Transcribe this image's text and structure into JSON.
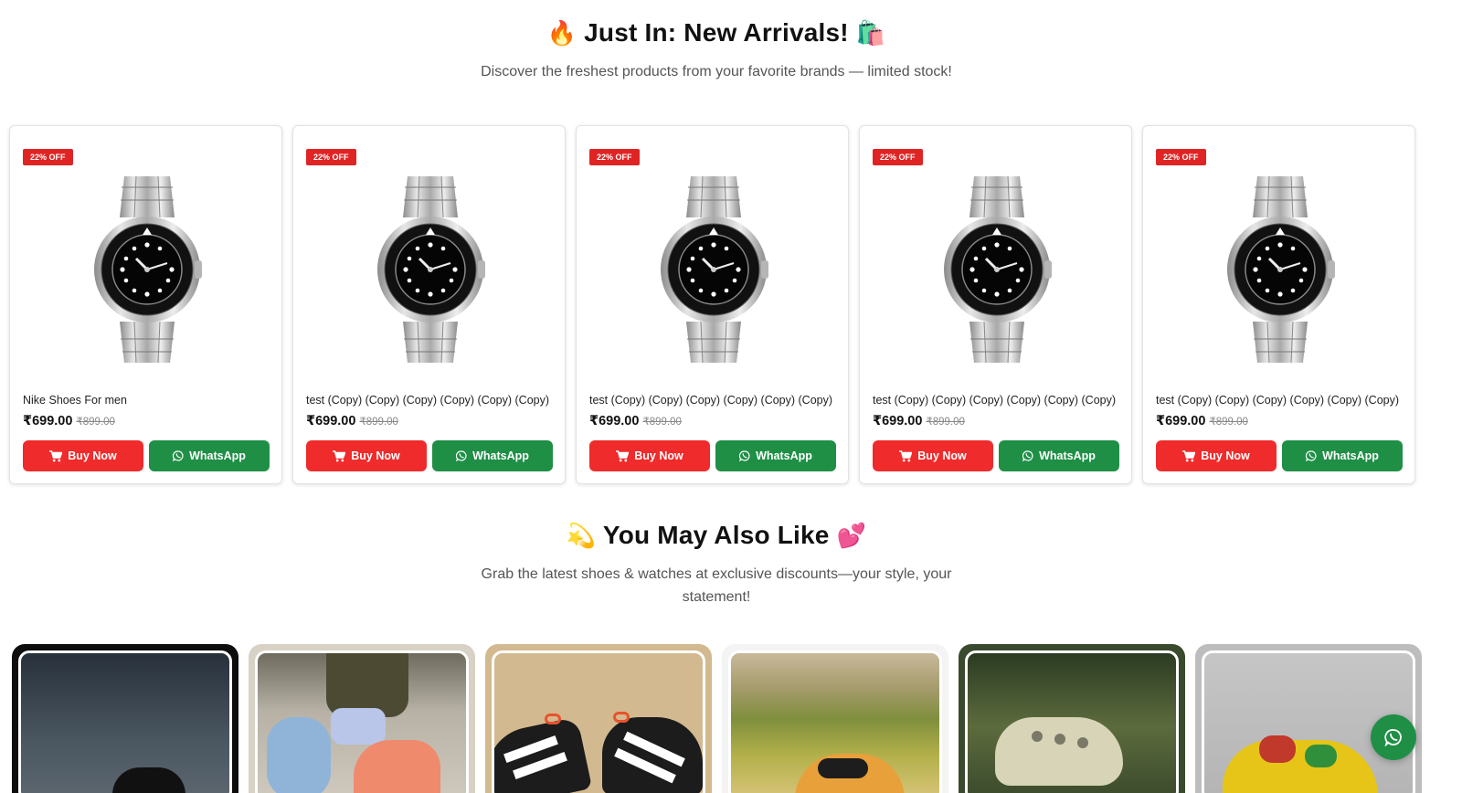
{
  "arrivals": {
    "title_emoji_left": "🔥",
    "title": "Just In: New Arrivals!",
    "title_emoji_right": "🛍️",
    "subtitle": "Discover the freshest products from your favorite brands — limited stock!"
  },
  "products": [
    {
      "badge": "22% OFF",
      "name": "Nike Shoes For men",
      "price": "₹699.00",
      "mrp": "₹899.00",
      "buy_label": "Buy Now",
      "whatsapp_label": "WhatsApp",
      "image_icon": "watch-image"
    },
    {
      "badge": "22% OFF",
      "name": "test (Copy) (Copy) (Copy) (Copy) (Copy) (Copy)",
      "price": "₹699.00",
      "mrp": "₹899.00",
      "buy_label": "Buy Now",
      "whatsapp_label": "WhatsApp",
      "image_icon": "watch-image"
    },
    {
      "badge": "22% OFF",
      "name": "test (Copy) (Copy) (Copy) (Copy) (Copy) (Copy)",
      "price": "₹699.00",
      "mrp": "₹899.00",
      "buy_label": "Buy Now",
      "whatsapp_label": "WhatsApp",
      "image_icon": "watch-image"
    },
    {
      "badge": "22% OFF",
      "name": "test (Copy) (Copy) (Copy) (Copy) (Copy) (Copy)",
      "price": "₹699.00",
      "mrp": "₹899.00",
      "buy_label": "Buy Now",
      "whatsapp_label": "WhatsApp",
      "image_icon": "watch-image"
    },
    {
      "badge": "22% OFF",
      "name": "test (Copy) (Copy) (Copy) (Copy) (Copy) (Copy)",
      "price": "₹699.00",
      "mrp": "₹899.00",
      "buy_label": "Buy Now",
      "whatsapp_label": "WhatsApp",
      "image_icon": "watch-image"
    }
  ],
  "also_like": {
    "title_emoji_left": "💫",
    "title": "You May Also Like",
    "title_emoji_right": "💕",
    "subtitle": "Grab the latest shoes & watches at exclusive discounts—your style, your statement!"
  },
  "tiles": [
    {
      "icon": "dark-shoe-photo"
    },
    {
      "icon": "sneaker-on-foot-photo"
    },
    {
      "icon": "adidas-shoes-photo"
    },
    {
      "icon": "running-shoe-field-photo"
    },
    {
      "icon": "clog-grass-photo"
    },
    {
      "icon": "yellow-sneaker-photo"
    }
  ],
  "colors": {
    "buy_button": "#ef2b2b",
    "whatsapp_button": "#1f8f46",
    "badge": "#e02424"
  },
  "fab": {
    "icon": "whatsapp-icon"
  }
}
